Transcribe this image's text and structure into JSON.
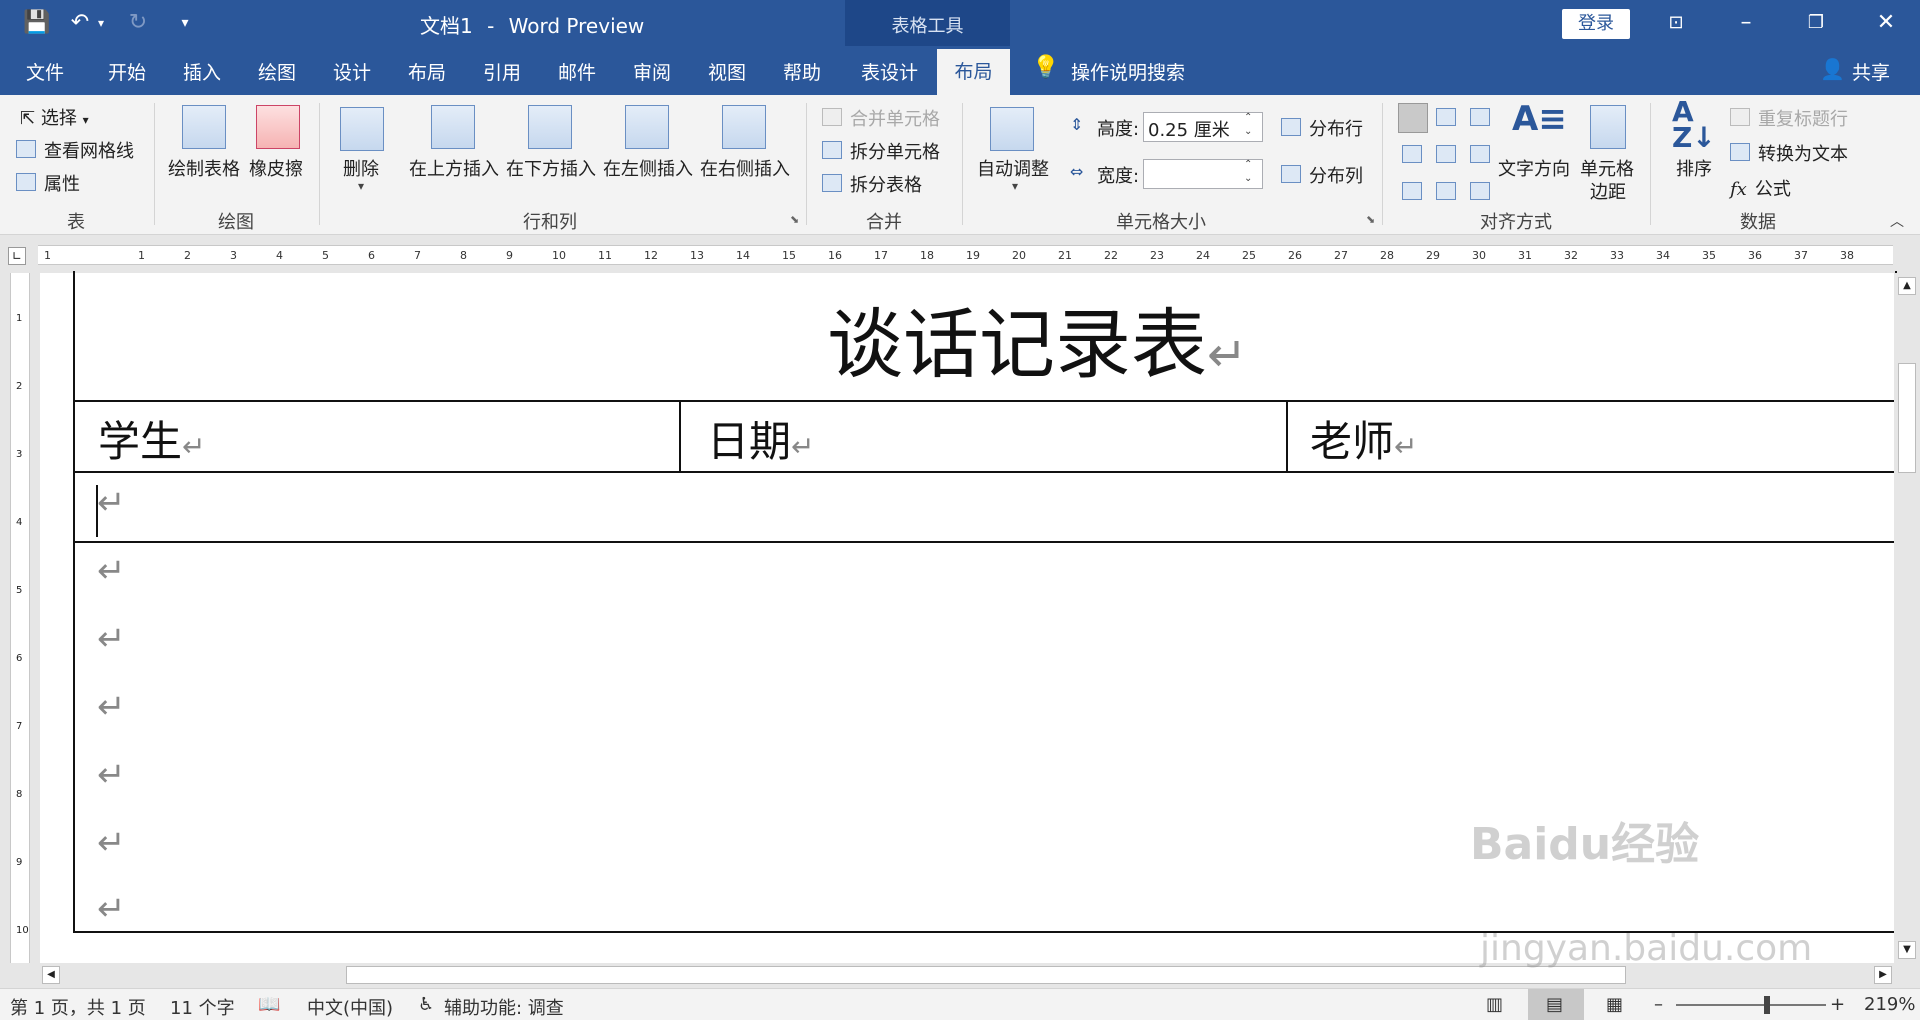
{
  "titlebar": {
    "doc_name": "文档1",
    "separator": "-",
    "app_name": "Word Preview",
    "context_tool": "表格工具",
    "login_label": "登录"
  },
  "tabs": [
    "文件",
    "开始",
    "插入",
    "绘图",
    "设计",
    "布局",
    "引用",
    "邮件",
    "审阅",
    "视图",
    "帮助",
    "表设计"
  ],
  "active_tab": "布局",
  "tell_me": "操作说明搜索",
  "share": "共享",
  "ribbon": {
    "table": {
      "select": "选择",
      "gridlines": "查看网格线",
      "properties": "属性",
      "label": "表"
    },
    "draw": {
      "draw_table": "绘制表格",
      "eraser": "橡皮擦",
      "label": "绘图"
    },
    "rows_cols": {
      "delete": "删除",
      "insert_above": "在上方插入",
      "insert_below": "在下方插入",
      "insert_left": "在左侧插入",
      "insert_right": "在右侧插入",
      "label": "行和列"
    },
    "merge": {
      "merge_cells": "合并单元格",
      "split_cells": "拆分单元格",
      "split_table": "拆分表格",
      "label": "合并"
    },
    "cell_size": {
      "autofit": "自动调整",
      "height_label": "高度:",
      "height_value": "0.25 厘米",
      "width_label": "宽度:",
      "width_value": "",
      "dist_rows": "分布行",
      "dist_cols": "分布列",
      "label": "单元格大小"
    },
    "alignment": {
      "text_direction": "文字方向",
      "cell_margins_1": "单元格",
      "cell_margins_2": "边距",
      "label": "对齐方式"
    },
    "data": {
      "sort": "排序",
      "repeat_header": "重复标题行",
      "convert_text": "转换为文本",
      "formula": "公式",
      "label": "数据"
    }
  },
  "ruler_ticks": [
    "1",
    "1",
    "2",
    "3",
    "4",
    "5",
    "6",
    "7",
    "8",
    "9",
    "10",
    "11",
    "12",
    "13",
    "14",
    "15",
    "16",
    "17",
    "18",
    "19",
    "20",
    "21",
    "22",
    "23",
    "24",
    "25",
    "26",
    "27",
    "28",
    "29",
    "30",
    "31",
    "32",
    "33",
    "34",
    "35",
    "36",
    "37",
    "38"
  ],
  "vruler_ticks": [
    "1",
    "2",
    "3",
    "4",
    "5",
    "6",
    "7",
    "8",
    "9",
    "10"
  ],
  "document": {
    "title": "谈话记录表",
    "headers": [
      "学生",
      "日期",
      "老师"
    ],
    "para_mark": "↵"
  },
  "statusbar": {
    "page": "第 1 页，共 1 页",
    "words": "11 个字",
    "language": "中文(中国)",
    "accessibility": "辅助功能: 调查",
    "zoom": "219%"
  },
  "watermark": {
    "line1": "Baidu经验",
    "line2": "jingyan.baidu.com"
  }
}
